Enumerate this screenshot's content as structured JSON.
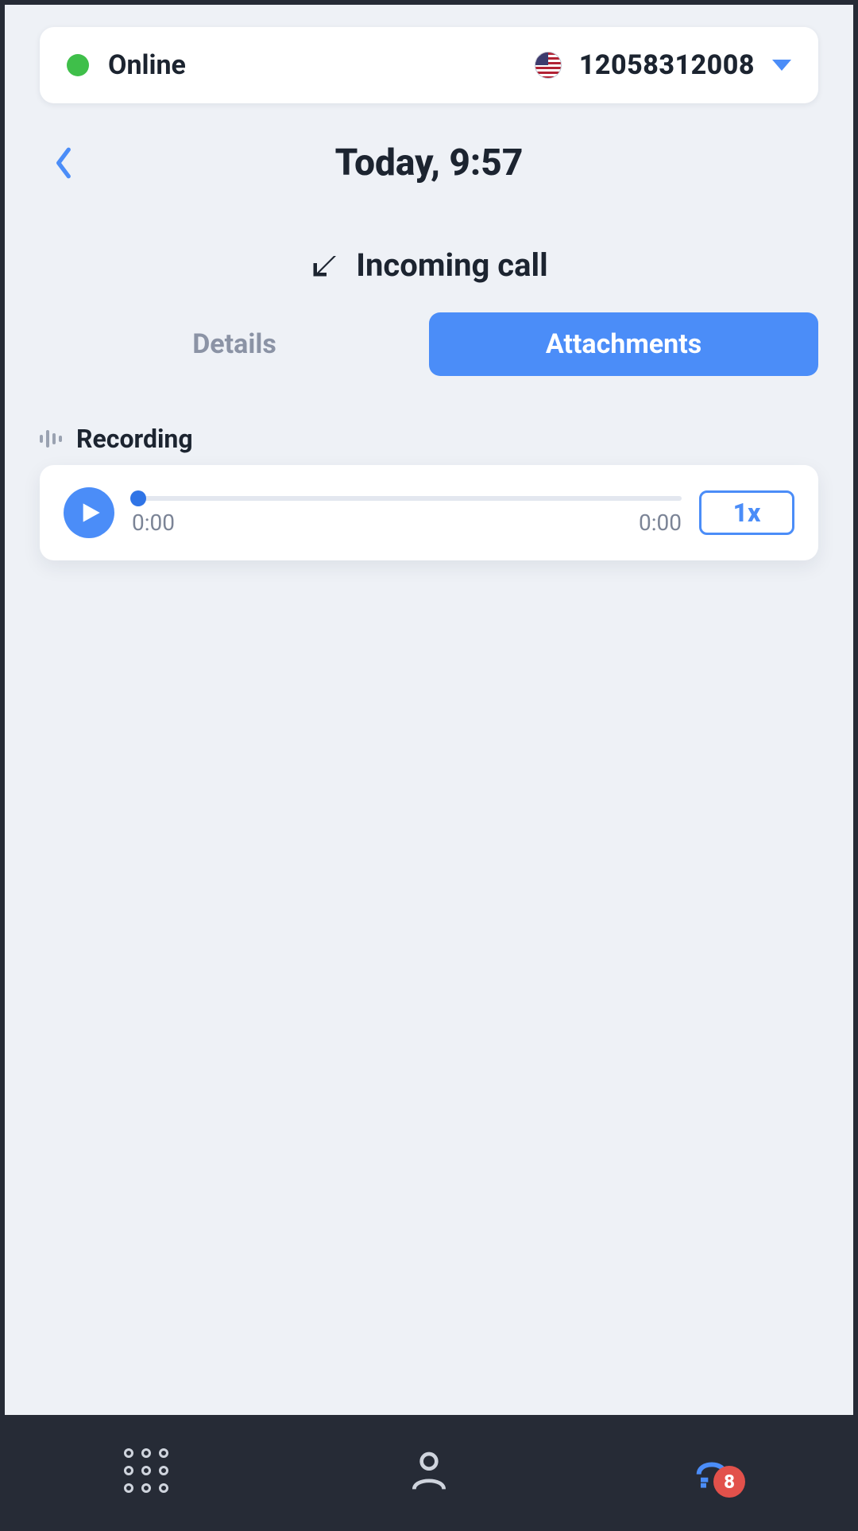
{
  "status": {
    "label": "Online",
    "phone_number": "12058312008"
  },
  "header": {
    "title": "Today, 9:57"
  },
  "call": {
    "direction_label": "Incoming call"
  },
  "tabs": {
    "details": "Details",
    "attachments": "Attachments"
  },
  "recording": {
    "section_title": "Recording",
    "current_time": "0:00",
    "total_time": "0:00",
    "speed_label": "1x"
  },
  "bottom_nav": {
    "badge_count": "8"
  }
}
